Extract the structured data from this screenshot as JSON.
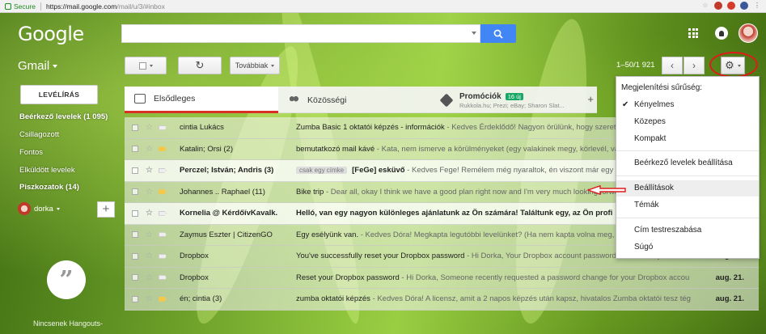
{
  "browser": {
    "secure_label": "Secure",
    "url_host": "https://mail.google.com",
    "url_path": "/mail/u/3/#inbox"
  },
  "header": {
    "logo_text": "Google",
    "app_label": "Gmail"
  },
  "toolbar": {
    "more_label": "Továbbiak",
    "pager_text": "1–50/1 921"
  },
  "sidebar": {
    "compose_label": "LEVÉLÍRÁS",
    "items": [
      {
        "label": "Beérkező levelek (1 095)",
        "bold": true
      },
      {
        "label": "Csillagozott",
        "bold": false
      },
      {
        "label": "Fontos",
        "bold": false
      },
      {
        "label": "Elküldött levelek",
        "bold": false
      },
      {
        "label": "Piszkozatok (14)",
        "bold": true
      }
    ],
    "account_name": "dorka",
    "hangouts_text": "Nincsenek Hangouts-"
  },
  "tabs": [
    {
      "label": "Elsődleges"
    },
    {
      "label": "Közösségi"
    },
    {
      "label": "Promóciók",
      "badge": "16 új",
      "sub": "Rukkola.hu; Prezi; eBay; Sharon Slat..."
    }
  ],
  "emails": [
    {
      "sender": "cintia Lukács",
      "subject": "Zumba Basic 1 oktatói képzés - információk",
      "snippet": " - Kedves Érdeklődő! Nagyon örülünk, hogy szeretn",
      "unread": false,
      "important": false,
      "label": "",
      "date": ""
    },
    {
      "sender": "Katalin; Orsi (2)",
      "subject": "bemutatkozó mail kávé",
      "snippet": " - Kata, nem ismerve a körülményeket (egy valakinek megy, körlevél, vag",
      "unread": false,
      "important": true,
      "label": "",
      "date": ""
    },
    {
      "sender": "Perczel; István; Andris (3)",
      "subject": "[FeGe] esküvő",
      "snippet": " - Kedves Fege! Remélem még nyaraltok, én viszont már egy",
      "unread": true,
      "important": false,
      "label": "csak egy címke",
      "date": ""
    },
    {
      "sender": "Johannes .. Raphael (11)",
      "subject": "Bike trip",
      "snippet": " - Dear all, okay I think we have a good plan right now and I'm very much looking forwar",
      "unread": false,
      "important": true,
      "label": "",
      "date": ""
    },
    {
      "sender": "Kornelia @ KérdőívKavalk.",
      "subject": "Helló, van egy nagyon különleges ajánlatunk az Ön számára! Találtunk egy, az Ön profi",
      "snippet": "",
      "unread": true,
      "important": false,
      "label": "",
      "date": ""
    },
    {
      "sender": "Zaymus Eszter | CitizenGO",
      "subject": "Egy esélyünk van.",
      "snippet": " - Kedves Dóra! Megkapta legutóbbi levelünket? (Ha nem kapta volna meg, az",
      "unread": false,
      "important": false,
      "label": "",
      "date": ""
    },
    {
      "sender": "Dropbox",
      "subject": "You've successfully reset your Dropbox password",
      "snippet": " - Hi Dorka, Your Dropbox account password was recently reset. Whi",
      "unread": false,
      "important": false,
      "label": "",
      "date": "aug. 21."
    },
    {
      "sender": "Dropbox",
      "subject": "Reset your Dropbox password",
      "snippet": " - Hi Dorka, Someone recently requested a password change for your Dropbox accou",
      "unread": false,
      "important": false,
      "label": "",
      "date": "aug. 21."
    },
    {
      "sender": "én; cintia (3)",
      "subject": "zumba oktatói képzés",
      "snippet": " - Kedves Dóra! A licensz, amit a 2 napos képzés után kapsz, hivatalos Zumba oktatói tesz tég",
      "unread": false,
      "important": true,
      "label": "",
      "date": "aug. 21."
    }
  ],
  "settings_menu": {
    "heading": "Megjelenítési sűrűség:",
    "density": [
      {
        "label": "Kényelmes",
        "checked": true
      },
      {
        "label": "Közepes",
        "checked": false
      },
      {
        "label": "Kompakt",
        "checked": false
      }
    ],
    "inbox_settings": "Beérkező levelek beállítása",
    "settings": "Beállítások",
    "themes": "Témák",
    "customize_address": "Cím testreszabása",
    "help": "Súgó"
  },
  "colors": {
    "accent_blue": "#4285f4",
    "annotation_red": "#e01b1b",
    "primary_tab_red": "#d93025",
    "promo_badge_green": "#16a765"
  }
}
